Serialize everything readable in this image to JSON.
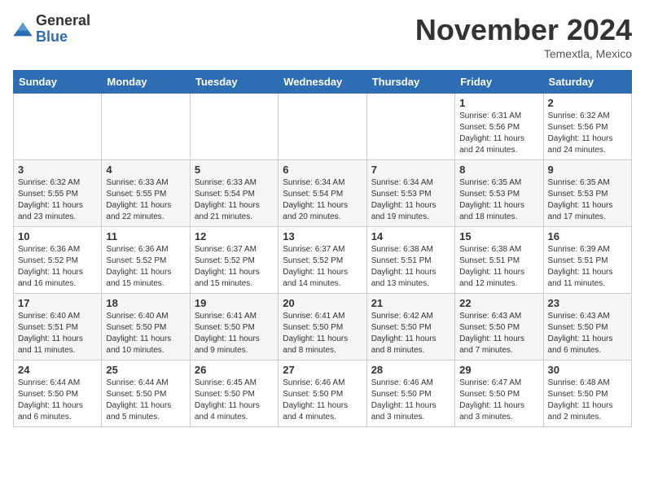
{
  "logo": {
    "general": "General",
    "blue": "Blue"
  },
  "header": {
    "month": "November 2024",
    "location": "Temextla, Mexico"
  },
  "weekdays": [
    "Sunday",
    "Monday",
    "Tuesday",
    "Wednesday",
    "Thursday",
    "Friday",
    "Saturday"
  ],
  "weeks": [
    [
      {
        "day": "",
        "info": ""
      },
      {
        "day": "",
        "info": ""
      },
      {
        "day": "",
        "info": ""
      },
      {
        "day": "",
        "info": ""
      },
      {
        "day": "",
        "info": ""
      },
      {
        "day": "1",
        "info": "Sunrise: 6:31 AM\nSunset: 5:56 PM\nDaylight: 11 hours and 24 minutes."
      },
      {
        "day": "2",
        "info": "Sunrise: 6:32 AM\nSunset: 5:56 PM\nDaylight: 11 hours and 24 minutes."
      }
    ],
    [
      {
        "day": "3",
        "info": "Sunrise: 6:32 AM\nSunset: 5:55 PM\nDaylight: 11 hours and 23 minutes."
      },
      {
        "day": "4",
        "info": "Sunrise: 6:33 AM\nSunset: 5:55 PM\nDaylight: 11 hours and 22 minutes."
      },
      {
        "day": "5",
        "info": "Sunrise: 6:33 AM\nSunset: 5:54 PM\nDaylight: 11 hours and 21 minutes."
      },
      {
        "day": "6",
        "info": "Sunrise: 6:34 AM\nSunset: 5:54 PM\nDaylight: 11 hours and 20 minutes."
      },
      {
        "day": "7",
        "info": "Sunrise: 6:34 AM\nSunset: 5:53 PM\nDaylight: 11 hours and 19 minutes."
      },
      {
        "day": "8",
        "info": "Sunrise: 6:35 AM\nSunset: 5:53 PM\nDaylight: 11 hours and 18 minutes."
      },
      {
        "day": "9",
        "info": "Sunrise: 6:35 AM\nSunset: 5:53 PM\nDaylight: 11 hours and 17 minutes."
      }
    ],
    [
      {
        "day": "10",
        "info": "Sunrise: 6:36 AM\nSunset: 5:52 PM\nDaylight: 11 hours and 16 minutes."
      },
      {
        "day": "11",
        "info": "Sunrise: 6:36 AM\nSunset: 5:52 PM\nDaylight: 11 hours and 15 minutes."
      },
      {
        "day": "12",
        "info": "Sunrise: 6:37 AM\nSunset: 5:52 PM\nDaylight: 11 hours and 15 minutes."
      },
      {
        "day": "13",
        "info": "Sunrise: 6:37 AM\nSunset: 5:52 PM\nDaylight: 11 hours and 14 minutes."
      },
      {
        "day": "14",
        "info": "Sunrise: 6:38 AM\nSunset: 5:51 PM\nDaylight: 11 hours and 13 minutes."
      },
      {
        "day": "15",
        "info": "Sunrise: 6:38 AM\nSunset: 5:51 PM\nDaylight: 11 hours and 12 minutes."
      },
      {
        "day": "16",
        "info": "Sunrise: 6:39 AM\nSunset: 5:51 PM\nDaylight: 11 hours and 11 minutes."
      }
    ],
    [
      {
        "day": "17",
        "info": "Sunrise: 6:40 AM\nSunset: 5:51 PM\nDaylight: 11 hours and 11 minutes."
      },
      {
        "day": "18",
        "info": "Sunrise: 6:40 AM\nSunset: 5:50 PM\nDaylight: 11 hours and 10 minutes."
      },
      {
        "day": "19",
        "info": "Sunrise: 6:41 AM\nSunset: 5:50 PM\nDaylight: 11 hours and 9 minutes."
      },
      {
        "day": "20",
        "info": "Sunrise: 6:41 AM\nSunset: 5:50 PM\nDaylight: 11 hours and 8 minutes."
      },
      {
        "day": "21",
        "info": "Sunrise: 6:42 AM\nSunset: 5:50 PM\nDaylight: 11 hours and 8 minutes."
      },
      {
        "day": "22",
        "info": "Sunrise: 6:43 AM\nSunset: 5:50 PM\nDaylight: 11 hours and 7 minutes."
      },
      {
        "day": "23",
        "info": "Sunrise: 6:43 AM\nSunset: 5:50 PM\nDaylight: 11 hours and 6 minutes."
      }
    ],
    [
      {
        "day": "24",
        "info": "Sunrise: 6:44 AM\nSunset: 5:50 PM\nDaylight: 11 hours and 6 minutes."
      },
      {
        "day": "25",
        "info": "Sunrise: 6:44 AM\nSunset: 5:50 PM\nDaylight: 11 hours and 5 minutes."
      },
      {
        "day": "26",
        "info": "Sunrise: 6:45 AM\nSunset: 5:50 PM\nDaylight: 11 hours and 4 minutes."
      },
      {
        "day": "27",
        "info": "Sunrise: 6:46 AM\nSunset: 5:50 PM\nDaylight: 11 hours and 4 minutes."
      },
      {
        "day": "28",
        "info": "Sunrise: 6:46 AM\nSunset: 5:50 PM\nDaylight: 11 hours and 3 minutes."
      },
      {
        "day": "29",
        "info": "Sunrise: 6:47 AM\nSunset: 5:50 PM\nDaylight: 11 hours and 3 minutes."
      },
      {
        "day": "30",
        "info": "Sunrise: 6:48 AM\nSunset: 5:50 PM\nDaylight: 11 hours and 2 minutes."
      }
    ]
  ]
}
